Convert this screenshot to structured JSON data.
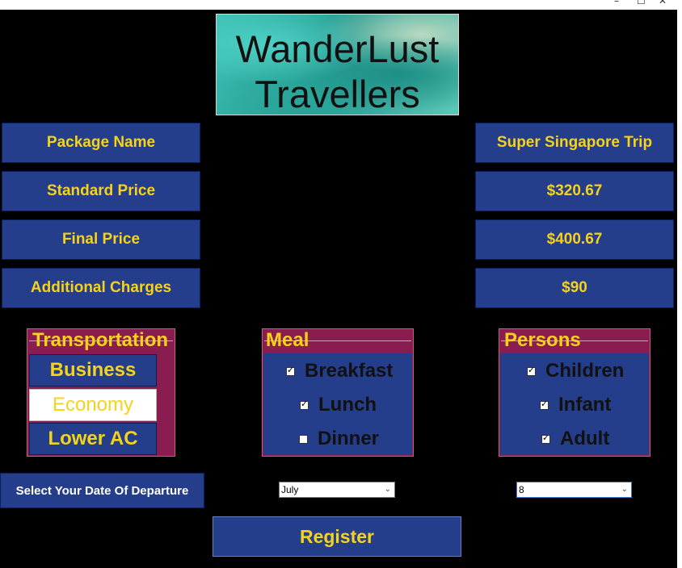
{
  "window": {
    "controls": [
      "–",
      "☐",
      "✕"
    ]
  },
  "logo": {
    "line1": "WanderLust",
    "line2": "Travellers"
  },
  "labels": {
    "package_name": "Package Name",
    "standard_price": "Standard Price",
    "final_price": "Final Price",
    "additional_charges": "Additional Charges"
  },
  "values": {
    "package_name": "Super Singapore Trip",
    "standard_price": "$320.67",
    "final_price": "$400.67",
    "additional_charges": "$90"
  },
  "transportation": {
    "title": "Transportation",
    "options": [
      "Business",
      "Economy",
      "Lower AC"
    ],
    "selected": "Economy"
  },
  "meal": {
    "title": "Meal",
    "items": [
      {
        "label": "Breakfast",
        "checked": true
      },
      {
        "label": "Lunch",
        "checked": true
      },
      {
        "label": "Dinner",
        "checked": false
      }
    ]
  },
  "persons": {
    "title": "Persons",
    "items": [
      {
        "label": "Children",
        "checked": true
      },
      {
        "label": "Infant",
        "checked": true
      },
      {
        "label": "Adult",
        "checked": true
      }
    ]
  },
  "departure": {
    "label": "Select Your Date Of Departure",
    "month_value": "July",
    "day_value": "8"
  },
  "register_label": "Register",
  "colors": {
    "background": "#000000",
    "panel": "#253e8c",
    "text_accent": "#f5d31a",
    "group_frame": "#8a1d4f"
  }
}
